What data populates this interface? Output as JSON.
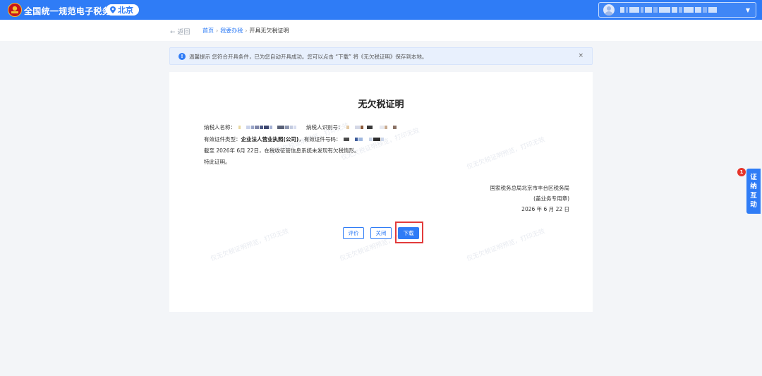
{
  "header": {
    "site_title": "全国统一规范电子税务局",
    "region": "北京"
  },
  "breadcrumb": {
    "back": "← 返回",
    "items": [
      "首页",
      "我要办税",
      "开具无欠税证明"
    ],
    "separator": "›"
  },
  "notice": {
    "icon": "!",
    "text": "温馨提示 您符合开具条件，已为您自动开具成功。您可以点击 “下载” 将《无欠税证明》保存到本地。",
    "close": "×"
  },
  "certificate": {
    "title": "无欠税证明",
    "taxpayer_name_label": "纳税人名称：",
    "taxpayer_id_label": "纳税人识别号：",
    "cert_type_label": "有效证件类型：",
    "cert_type_value": "企业法人营业执照(公司)",
    "cert_number_label": "，有效证件号码：",
    "statement": "截至 2026年 6月 22日，在税收征管信息系统未发现有欠税情形。",
    "closing": "特此证明。",
    "issuer": "国家税务总局北京市丰台区税务局",
    "seal": "(盖业务专用章)",
    "date": "2026 年 6 月 22 日",
    "watermark": "仅无欠税证明预览，打印无效"
  },
  "actions": {
    "evaluate": "评价",
    "close": "关闭",
    "download": "下载"
  },
  "side_float": {
    "label": "证纳互动",
    "badge": "1"
  },
  "colors": {
    "primary": "#2f7cf6",
    "highlight": "#e23b3b",
    "badge": "#e6352c"
  }
}
